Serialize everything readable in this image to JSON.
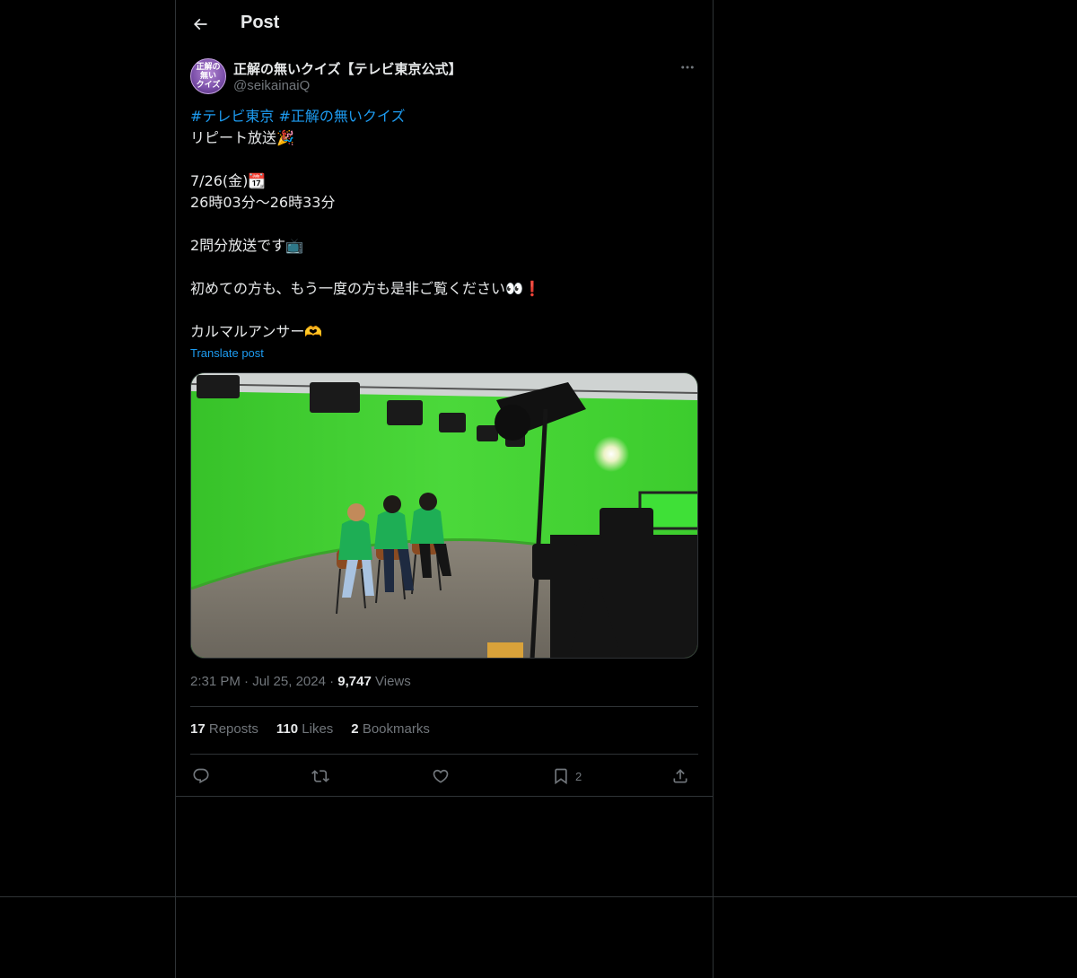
{
  "header": {
    "title": "Post"
  },
  "author": {
    "display_name": "正解の無いクイズ【テレビ東京公式】",
    "handle": "@seikainaiQ",
    "avatar_text_1": "正解の",
    "avatar_text_2": "無い",
    "avatar_text_3": "クイズ"
  },
  "post": {
    "hashtag_1": "#テレビ東京",
    "hashtag_2": "#正解の無いクイズ",
    "line_1": "リピート放送🎉",
    "line_2": "7/26(金)📆",
    "line_3": "26時03分〜26時33分",
    "line_4": "2問分放送です📺",
    "line_5": "初めての方も、もう一度の方も是非ご覧ください👀❗",
    "line_6": "カルマルアンサー🫶"
  },
  "translate_label": "Translate post",
  "meta": {
    "time": "2:31 PM",
    "sep": "·",
    "date": "Jul 25, 2024",
    "views_count": "9,747",
    "views_label": "Views"
  },
  "stats": {
    "reposts_count": "17",
    "reposts_label": "Reposts",
    "likes_count": "110",
    "likes_label": "Likes",
    "bookmarks_count": "2",
    "bookmarks_label": "Bookmarks"
  },
  "actions": {
    "bookmark_count": "2"
  },
  "colors": {
    "background": "#000000",
    "border": "#2f3336",
    "link": "#1d9bf0",
    "secondary_text": "#71767b",
    "primary_text": "#e7e9ea"
  },
  "icons": [
    "back-arrow-icon",
    "more-icon",
    "reply-icon",
    "repost-icon",
    "like-icon",
    "bookmark-icon",
    "share-icon"
  ]
}
